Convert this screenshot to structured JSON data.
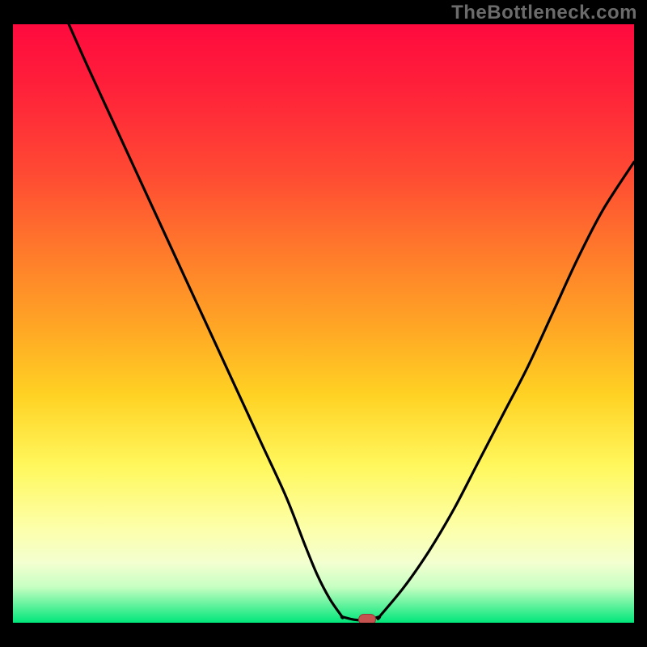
{
  "watermark": "TheBottleneck.com",
  "colors": {
    "background": "#000000",
    "watermark_text": "#6b6b6b",
    "curve": "#000000",
    "marker": "#c6524f",
    "gradient_stops": [
      "#ff0a3e",
      "#ff1f3a",
      "#ff4a33",
      "#ff7a2b",
      "#ffa425",
      "#ffd223",
      "#fff85e",
      "#fdffa8",
      "#f3ffd0",
      "#c7ffc2",
      "#00e67a"
    ]
  },
  "chart_data": {
    "type": "line",
    "title": "",
    "xlabel": "",
    "ylabel": "",
    "xlim": [
      0,
      100
    ],
    "ylim": [
      0,
      100
    ],
    "grid": false,
    "legend": false,
    "series": [
      {
        "name": "left-branch",
        "x": [
          9,
          12,
          16,
          20,
          24,
          28,
          32,
          36,
          40,
          44,
          47,
          49,
          51,
          53
        ],
        "values": [
          100,
          93,
          84,
          75,
          66,
          57,
          48,
          39,
          30,
          21,
          13,
          8,
          4,
          1
        ]
      },
      {
        "name": "valley-floor",
        "x": [
          53,
          55,
          57,
          59
        ],
        "values": [
          1,
          0.5,
          0.5,
          1
        ]
      },
      {
        "name": "right-branch",
        "x": [
          59,
          63,
          67,
          71,
          75,
          79,
          83,
          87,
          91,
          95,
          100
        ],
        "values": [
          1,
          6,
          12,
          19,
          27,
          35,
          43,
          52,
          61,
          69,
          77
        ]
      }
    ],
    "annotations": [
      {
        "name": "min-marker",
        "x": 57,
        "y": 0.5
      }
    ]
  }
}
